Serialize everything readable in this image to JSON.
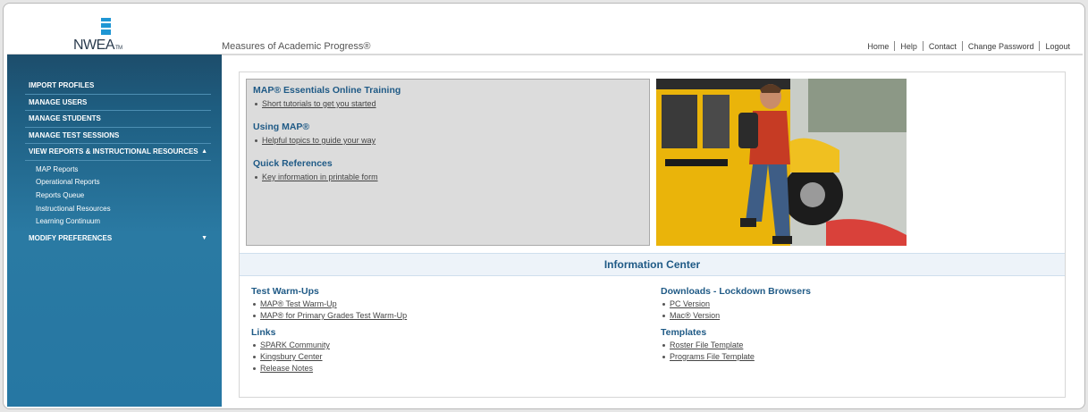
{
  "header": {
    "logo_text": "NWEA",
    "logo_tm": "TM",
    "app_title": "Measures of Academic Progress®",
    "nav": [
      "Home",
      "Help",
      "Contact",
      "Change Password",
      "Logout"
    ]
  },
  "sidebar": {
    "items": [
      {
        "label": "IMPORT PROFILES"
      },
      {
        "label": "MANAGE USERS"
      },
      {
        "label": "MANAGE STUDENTS"
      },
      {
        "label": "MANAGE TEST SESSIONS"
      },
      {
        "label": "VIEW REPORTS & INSTRUCTIONAL RESOURCES",
        "caret": "▲"
      }
    ],
    "subitems": [
      "MAP Reports",
      "Operational Reports",
      "Reports Queue",
      "Instructional Resources",
      "Learning Continuum"
    ],
    "last_item": {
      "label": "MODIFY PREFERENCES",
      "caret": "▼"
    }
  },
  "training": {
    "sections": [
      {
        "title": "MAP® Essentials Online Training",
        "link": "Short tutorials to get you started"
      },
      {
        "title": "Using MAP®",
        "link": "Helpful topics to guide your way"
      },
      {
        "title": "Quick References",
        "link": "Key information in printable form"
      }
    ]
  },
  "info_center": {
    "title": "Information Center",
    "left": [
      {
        "title": "Test Warm-Ups",
        "links": [
          "MAP® Test Warm-Up",
          "MAP® for Primary Grades Test Warm-Up"
        ]
      },
      {
        "title": "Links",
        "links": [
          "SPARK Community",
          "Kingsbury Center",
          "Release Notes"
        ]
      }
    ],
    "right": [
      {
        "title": "Downloads - Lockdown Browsers",
        "links": [
          "PC Version",
          "Mac® Version"
        ]
      },
      {
        "title": "Templates",
        "links": [
          "Roster File Template",
          "Programs File Template"
        ]
      }
    ]
  },
  "colors": {
    "sidebar_top": "#1d4d6b",
    "sidebar_bottom": "#2677a3",
    "heading_blue": "#1f5a86",
    "logo_blue": "#1f96d4"
  }
}
